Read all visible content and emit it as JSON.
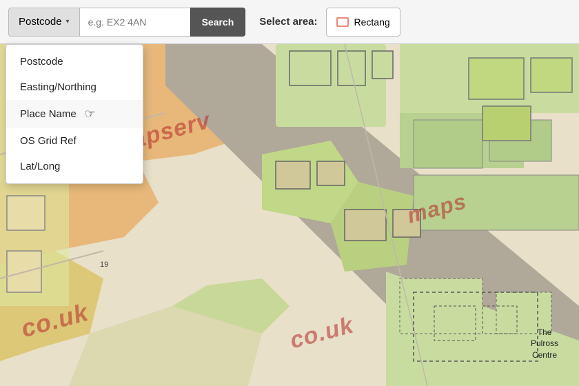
{
  "toolbar": {
    "postcode_label": "Postcode",
    "dropdown_arrow": "▾",
    "search_placeholder": "e.g. EX2 4AN",
    "search_label": "Search",
    "select_area_label": "Select area:",
    "rectangle_label": "Rectang"
  },
  "dropdown": {
    "items": [
      {
        "id": "postcode",
        "label": "Postcode"
      },
      {
        "id": "easting-northing",
        "label": "Easting/Northing"
      },
      {
        "id": "place-name",
        "label": "Place Name"
      },
      {
        "id": "os-grid-ref",
        "label": "OS Grid Ref"
      },
      {
        "id": "lat-long",
        "label": "Lat/Long"
      }
    ]
  },
  "map": {
    "watermarks": [
      {
        "text": "mapserv"
      },
      {
        "text": "co.uk"
      },
      {
        "text": "maps"
      },
      {
        "text": "co.uk"
      }
    ]
  },
  "labels": {
    "pulross_line1": "The",
    "pulross_line2": "Pulross",
    "pulross_line3": "Centre",
    "number_19": "19"
  }
}
